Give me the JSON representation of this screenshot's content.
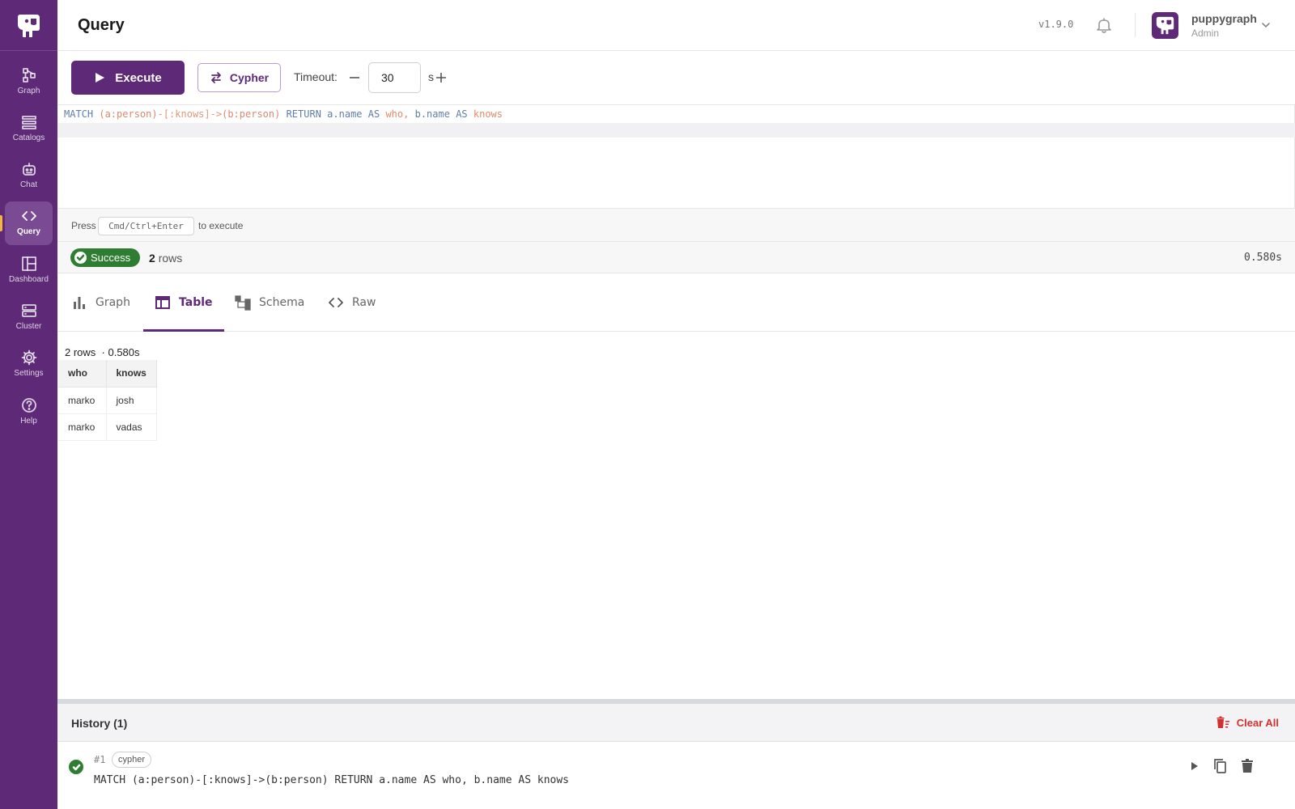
{
  "sidebar": {
    "items": [
      {
        "label": "Graph",
        "icon": "graph-nodes-icon"
      },
      {
        "label": "Catalogs",
        "icon": "catalogs-icon"
      },
      {
        "label": "Chat",
        "icon": "robot-chat-icon"
      },
      {
        "label": "Query",
        "icon": "code-icon",
        "active": true
      },
      {
        "label": "Dashboard",
        "icon": "dashboard-icon"
      },
      {
        "label": "Cluster",
        "icon": "cluster-icon"
      },
      {
        "label": "Settings",
        "icon": "gear-icon"
      },
      {
        "label": "Help",
        "icon": "help-icon"
      }
    ]
  },
  "header": {
    "title": "Query",
    "version": "v1.9.0",
    "user": {
      "name": "puppygraph",
      "role": "Admin"
    }
  },
  "toolbar": {
    "execute_label": "Execute",
    "language_label": "Cypher",
    "timeout_label": "Timeout:",
    "timeout_value": "30",
    "timeout_unit": "s"
  },
  "editor": {
    "tokens": {
      "match": "MATCH",
      "pattern_a": "(a:person)",
      "rel": "-[:knows]->",
      "pattern_b": "(b:person)",
      "return": "RETURN",
      "a_name": "a.name",
      "as1": "AS",
      "who": "who,",
      "b_name": "b.name",
      "as2": "AS",
      "knows": "knows"
    }
  },
  "hint": {
    "press": "Press",
    "shortcut": "Cmd/Ctrl+Enter",
    "suffix": "to execute"
  },
  "status": {
    "badge": "Success",
    "rows_count": "2",
    "rows_word": "rows",
    "time": "0.580s"
  },
  "tabs": [
    {
      "label": "Graph",
      "icon": "bar-chart-icon"
    },
    {
      "label": "Table",
      "icon": "table-icon",
      "active": true
    },
    {
      "label": "Schema",
      "icon": "schema-icon"
    },
    {
      "label": "Raw",
      "icon": "code-icon"
    }
  ],
  "results": {
    "meta": "2 rows",
    "meta_time": "· 0.580s",
    "columns": [
      "who",
      "knows"
    ],
    "rows": [
      [
        "marko",
        "josh"
      ],
      [
        "marko",
        "vadas"
      ]
    ]
  },
  "history": {
    "title": "History (1)",
    "clear_label": "Clear All",
    "items": [
      {
        "index": "#1",
        "language": "cypher",
        "query": "MATCH (a:person)-[:knows]->(b:person) RETURN a.name AS who, b.name AS knows"
      }
    ]
  },
  "colors": {
    "brand": "#5e2a78",
    "success": "#2e7d32",
    "danger": "#d32f2f",
    "active_marker": "#f2b73c"
  }
}
